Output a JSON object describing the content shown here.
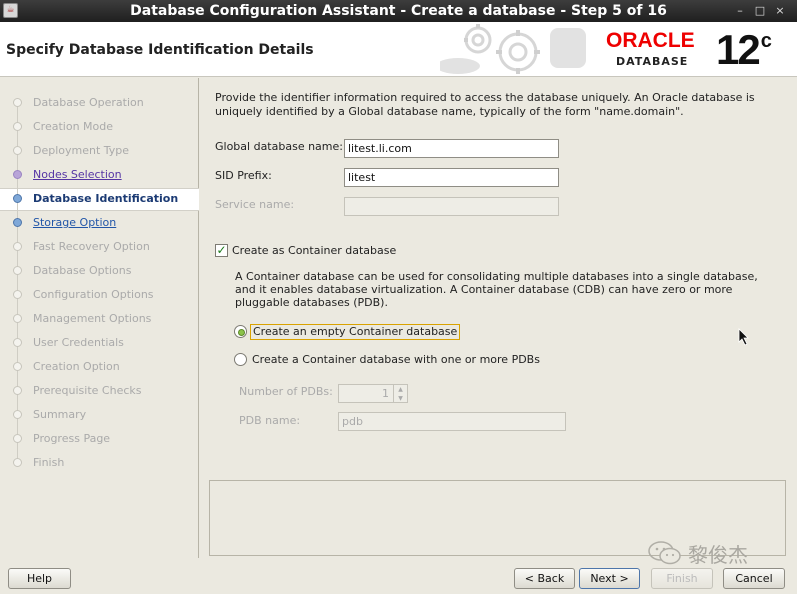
{
  "window": {
    "title": "Database Configuration Assistant - Create a database - Step 5 of 16",
    "controls": [
      "–",
      "□",
      "×"
    ]
  },
  "header": {
    "page_title": "Specify Database Identification Details",
    "logo_text": "ORACLE",
    "logo_sub": "DATABASE",
    "version": "12",
    "version_sup": "c"
  },
  "steps": [
    {
      "label": "Database Operation",
      "state": "disabled"
    },
    {
      "label": "Creation Mode",
      "state": "disabled"
    },
    {
      "label": "Deployment Type",
      "state": "disabled"
    },
    {
      "label": "Nodes Selection",
      "state": "visited"
    },
    {
      "label": "Database Identification",
      "state": "current"
    },
    {
      "label": "Storage Option",
      "state": "link"
    },
    {
      "label": "Fast Recovery Option",
      "state": "disabled"
    },
    {
      "label": "Database Options",
      "state": "disabled"
    },
    {
      "label": "Configuration Options",
      "state": "disabled"
    },
    {
      "label": "Management Options",
      "state": "disabled"
    },
    {
      "label": "User Credentials",
      "state": "disabled"
    },
    {
      "label": "Creation Option",
      "state": "disabled"
    },
    {
      "label": "Prerequisite Checks",
      "state": "disabled"
    },
    {
      "label": "Summary",
      "state": "disabled"
    },
    {
      "label": "Progress Page",
      "state": "disabled"
    },
    {
      "label": "Finish",
      "state": "disabled"
    }
  ],
  "form": {
    "description": "Provide the identifier information required to access the database uniquely. An Oracle database is uniquely identified by a Global database name, typically of the form \"name.domain\".",
    "global_db_name_label": "Global database name:",
    "global_db_name_value": "litest.li.com",
    "sid_prefix_label": "SID Prefix:",
    "sid_prefix_value": "litest",
    "service_name_label": "Service name:",
    "service_name_value": "",
    "container_checkbox_label": "Create as Container database",
    "container_checked": true,
    "container_desc": "A Container database can be used for consolidating multiple databases into a single database, and it enables database virtualization. A Container database (CDB) can have zero or more pluggable databases (PDB).",
    "radio_empty_label": "Create an empty Container database",
    "radio_pdbs_label": "Create a Container database with one or more PDBs",
    "num_pdbs_label": "Number of PDBs:",
    "num_pdbs_value": "1",
    "pdb_name_label": "PDB name:",
    "pdb_name_value": "pdb"
  },
  "buttons": {
    "help": "Help",
    "back": "< Back",
    "next": "Next >",
    "finish": "Finish",
    "cancel": "Cancel"
  },
  "watermark": "黎俊杰",
  "colors": {
    "oracle_red": "#e00000",
    "active_step": "#1c3b74",
    "link_step": "#2256a8",
    "visited_step": "#5534a4",
    "check_green": "#1a7a1a",
    "focus_border": "#d9a200"
  }
}
